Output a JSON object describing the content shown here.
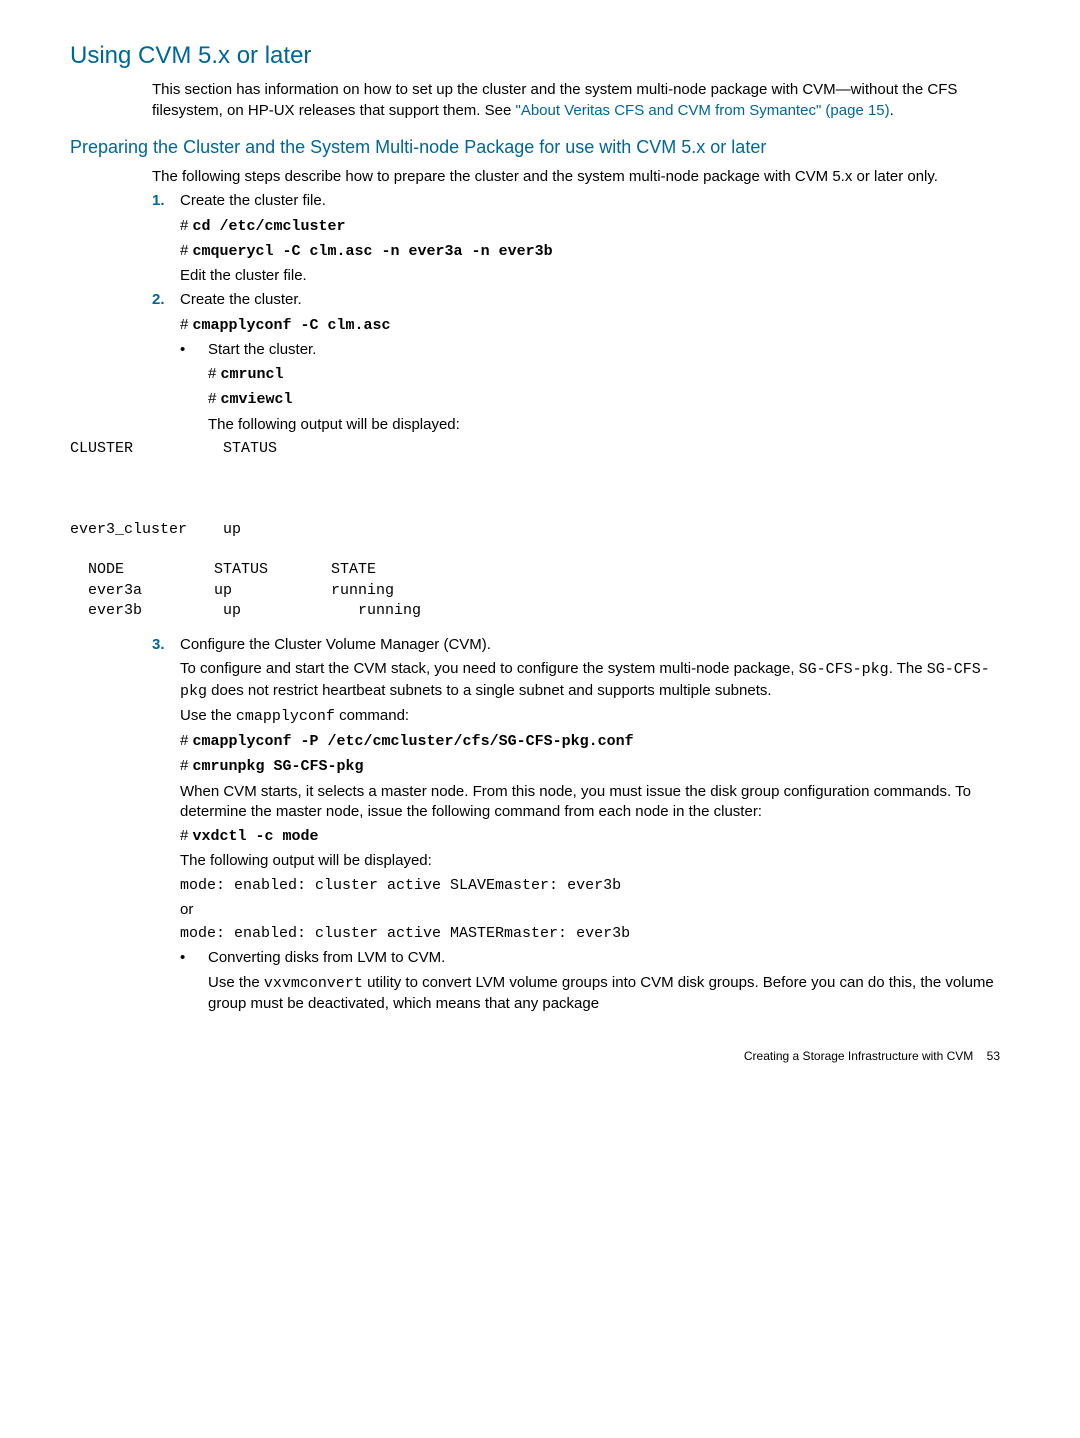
{
  "h2": "Using CVM 5.x or later",
  "intro1": "This section has information on how to set up the cluster and the system multi-node package with CVM—without the CFS filesystem, on HP-UX releases that support them. See ",
  "intro_link": "\"About Veritas CFS and CVM from Symantec\" (page 15)",
  "intro_end": ".",
  "h3": "Preparing the Cluster and the System Multi-node Package for use with CVM 5.x or later",
  "prep_intro": "The following steps describe how to prepare the cluster and the system multi-node package with CVM 5.x or later only.",
  "steps": {
    "s1_num": "1.",
    "s1_txt": "Create the cluster file.",
    "s1_cmd1_hash": "# ",
    "s1_cmd1": "cd /etc/cmcluster",
    "s1_cmd2_hash": "# ",
    "s1_cmd2": "cmquerycl -C clm.asc -n ever3a -n ever3b",
    "s1_note": "Edit the cluster file.",
    "s2_num": "2.",
    "s2_txt": "Create the cluster.",
    "s2_cmd1_hash": "# ",
    "s2_cmd1": "cmapplyconf -C clm.asc",
    "s2_b1": "Start the cluster.",
    "s2_cmd2_hash": "# ",
    "s2_cmd2": "cmruncl",
    "s2_cmd3_hash": "# ",
    "s2_cmd3": "cmviewcl",
    "s2_note": "The following output will be displayed:",
    "s2_out": "CLUSTER          STATUS  \n\n\n\never3_cluster    up\n\n  NODE          STATUS       STATE      \n  ever3a        up           running\n  ever3b         up             running",
    "s3_num": "3.",
    "s3_txt": "Configure the Cluster Volume Manager (CVM).",
    "s3_p1a": "To configure and start the CVM stack, you need to configure the system multi-node package, ",
    "s3_p1b": "SG-CFS-pkg",
    "s3_p1c": ". The ",
    "s3_p1d": "SG-CFS-pkg",
    "s3_p1e": " does not restrict heartbeat subnets to a single subnet and supports multiple subnets.",
    "s3_use_a": "Use the ",
    "s3_use_b": "cmapplyconf",
    "s3_use_c": " command:",
    "s3_cmd1_hash": "# ",
    "s3_cmd1": "cmapplyconf -P /etc/cmcluster/cfs/SG-CFS-pkg.conf",
    "s3_cmd2_hash": "# ",
    "s3_cmd2": "cmrunpkg SG-CFS-pkg",
    "s3_p2": "When CVM starts, it selects a master node. From this node, you must issue the disk group configuration commands. To determine the master node, issue the following command from each node in the cluster:",
    "s3_cmd3_hash": "# ",
    "s3_cmd3": "vxdctl -c mode",
    "s3_note": "The following output will be displayed:",
    "s3_out1": "mode: enabled: cluster active SLAVEmaster: ever3b",
    "s3_or": "or",
    "s3_out2": "mode: enabled: cluster active MASTERmaster: ever3b",
    "s3_b1": "Converting disks from LVM to CVM.",
    "s3_b1_pa": "Use the ",
    "s3_b1_pb": "vxvmconvert",
    "s3_b1_pc": " utility to convert LVM volume groups into CVM disk groups. Before you can do this, the volume group must be deactivated, which means that any package"
  },
  "footer_txt": "Creating a Storage Infrastructure with CVM",
  "footer_page": "53"
}
